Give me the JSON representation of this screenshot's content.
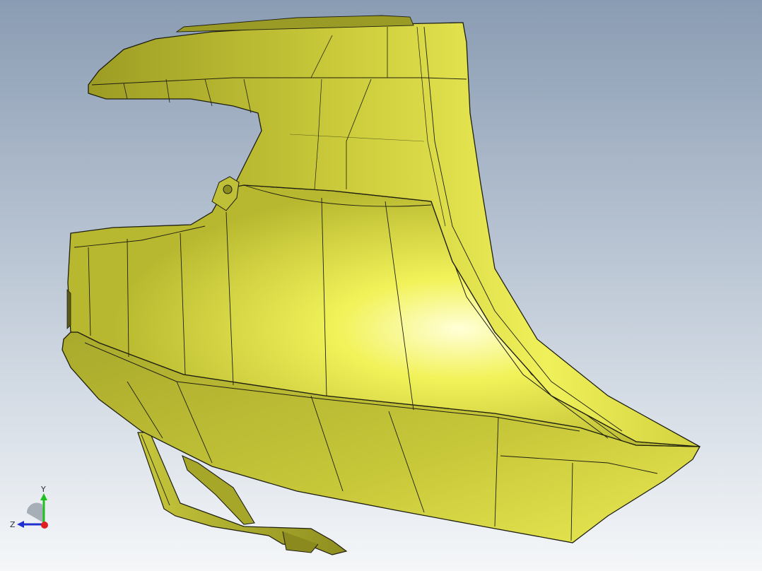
{
  "viewport": {
    "background_top": "#8c9db4",
    "background_bottom": "#f4f6f8"
  },
  "model": {
    "part": "bumper-shell",
    "surface_color": "#e8e84c",
    "edge_color": "#1e1e10"
  },
  "triad": {
    "x_label": "",
    "y_label": "Y",
    "z_label": "Z",
    "x_color": "#e02020",
    "y_color": "#1fbf1f",
    "z_color": "#2030d0"
  }
}
